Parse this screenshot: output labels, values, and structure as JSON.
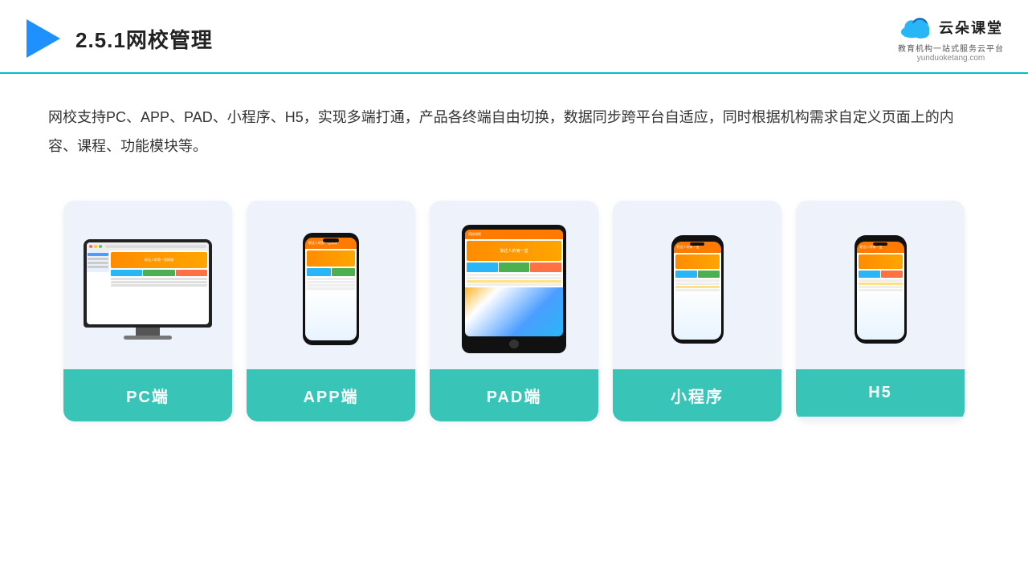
{
  "header": {
    "title": "2.5.1网校管理",
    "logo_name": "云朵课堂",
    "logo_url": "yunduoketang.com",
    "logo_tagline": "教育机构一站\n式服务云平台"
  },
  "description": "网校支持PC、APP、PAD、小程序、H5，实现多端打通，产品各终端自由切换，数据同步跨平台自适应，同时根据机构需求自定义页面上的内容、课程、功能模块等。",
  "cards": [
    {
      "id": "pc",
      "label": "PC端"
    },
    {
      "id": "app",
      "label": "APP端"
    },
    {
      "id": "pad",
      "label": "PAD端"
    },
    {
      "id": "miniapp",
      "label": "小程序"
    },
    {
      "id": "h5",
      "label": "H5"
    }
  ],
  "accent_color": "#38c5b8"
}
